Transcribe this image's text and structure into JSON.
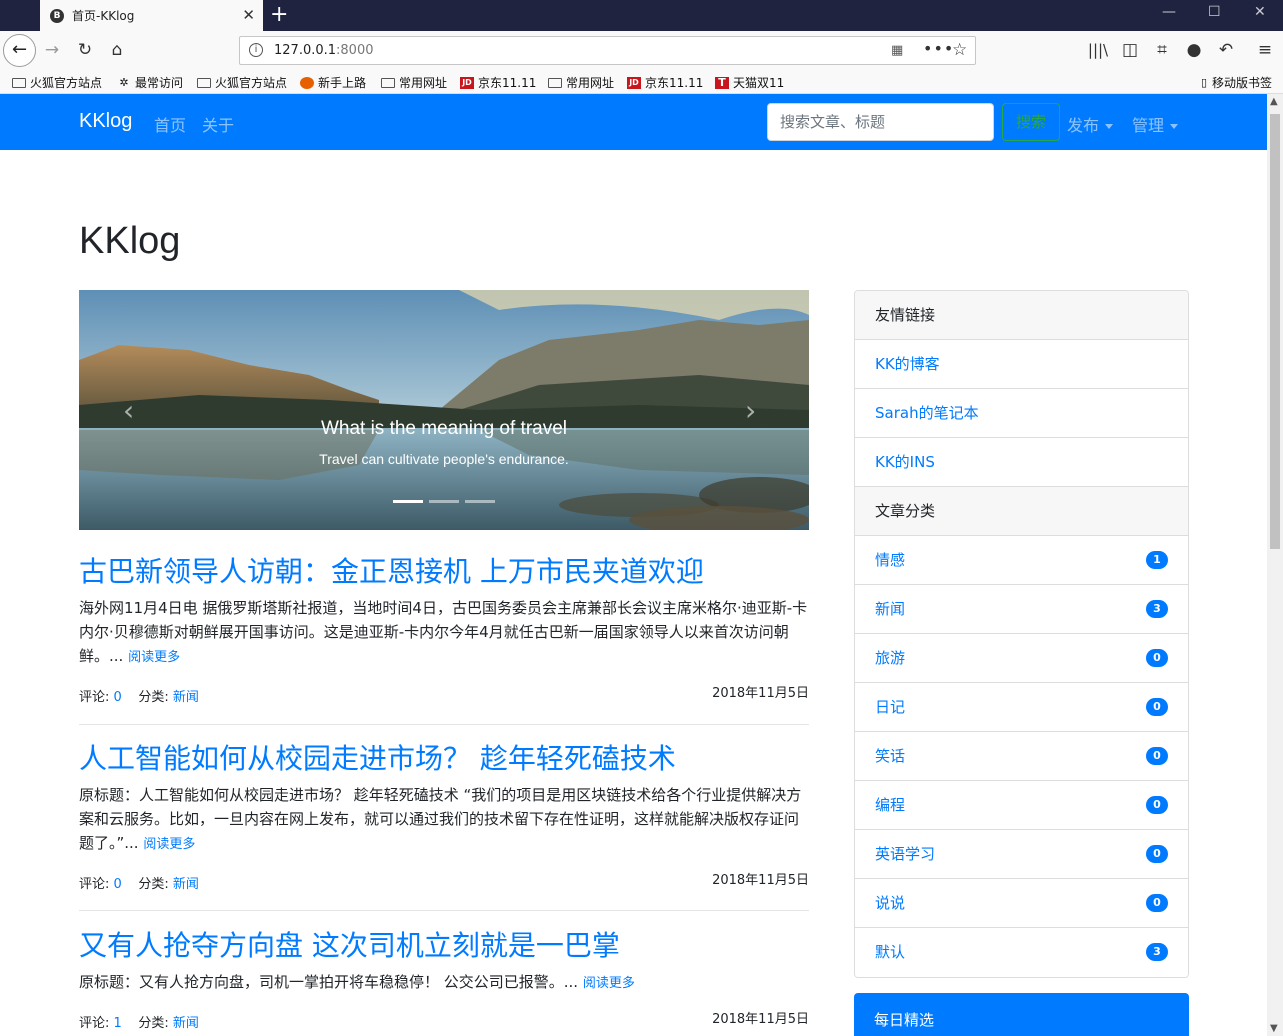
{
  "browser": {
    "tab_title": "首页-KKlog",
    "tab_favicon": "B",
    "url_host": "127.0.0.1",
    "url_port": ":8000",
    "bookmarks": [
      "火狐官方站点",
      "最常访问",
      "火狐官方站点",
      "新手上路",
      "常用网址",
      "京东11.11",
      "常用网址",
      "京东11.11",
      "天猫双11"
    ],
    "mobile_bookmarks": "移动版书签"
  },
  "nav": {
    "brand": "KKlog",
    "links": [
      "首页",
      "关于"
    ],
    "search_placeholder": "搜索文章、标题",
    "search_button": "搜索",
    "dropdowns": [
      "发布",
      "管理"
    ],
    "accent_color": "#007bff"
  },
  "page_title": "KKlog",
  "carousel": {
    "caption_title": "What is the meaning of travel",
    "caption_text": "Travel can cultivate people's endurance.",
    "prev_icon": "‹",
    "next_icon": "›",
    "slides": 3,
    "active_slide": 1
  },
  "posts": [
    {
      "title": "古巴新领导人访朝：金正恩接机 上万市民夹道欢迎",
      "summary": "海外网11月4日电 据俄罗斯塔斯社报道，当地时间4日，古巴国务委员会主席兼部长会议主席米格尔·迪亚斯-卡内尔·贝穆德斯对朝鲜展开国事访问。这是迪亚斯-卡内尔今年4月就任古巴新一届国家领导人以来首次访问朝鲜。...",
      "read_more": "阅读更多",
      "comments_label": "评论:",
      "comments": "0",
      "category_label": "分类:",
      "category": "新闻",
      "date": "2018年11月5日"
    },
    {
      "title": "人工智能如何从校园走进市场？ 趁年轻死磕技术",
      "summary": "原标题：人工智能如何从校园走进市场？ 趁年轻死磕技术 “我们的项目是用区块链技术给各个行业提供解决方案和云服务。比如，一旦内容在网上发布，就可以通过我们的技术留下存在性证明，这样就能解决版权存证问题了。”...",
      "read_more": "阅读更多",
      "comments_label": "评论:",
      "comments": "0",
      "category_label": "分类:",
      "category": "新闻",
      "date": "2018年11月5日"
    },
    {
      "title": "又有人抢夺方向盘 这次司机立刻就是一巴掌",
      "summary": "原标题：又有人抢方向盘，司机一掌拍开将车稳稳停！ 公交公司已报警。...",
      "read_more": "阅读更多",
      "comments_label": "评论:",
      "comments": "1",
      "category_label": "分类:",
      "category": "新闻",
      "date": "2018年11月5日"
    }
  ],
  "sidebar": {
    "links_title": "友情链接",
    "links": [
      "KK的博客",
      "Sarah的笔记本",
      "KK的INS"
    ],
    "categories_title": "文章分类",
    "categories": [
      {
        "name": "情感",
        "count": "1"
      },
      {
        "name": "新闻",
        "count": "3"
      },
      {
        "name": "旅游",
        "count": "0"
      },
      {
        "name": "日记",
        "count": "0"
      },
      {
        "name": "笑话",
        "count": "0"
      },
      {
        "name": "编程",
        "count": "0"
      },
      {
        "name": "英语学习",
        "count": "0"
      },
      {
        "name": "说说",
        "count": "0"
      },
      {
        "name": "默认",
        "count": "3"
      }
    ],
    "daily_title": "每日精选"
  }
}
